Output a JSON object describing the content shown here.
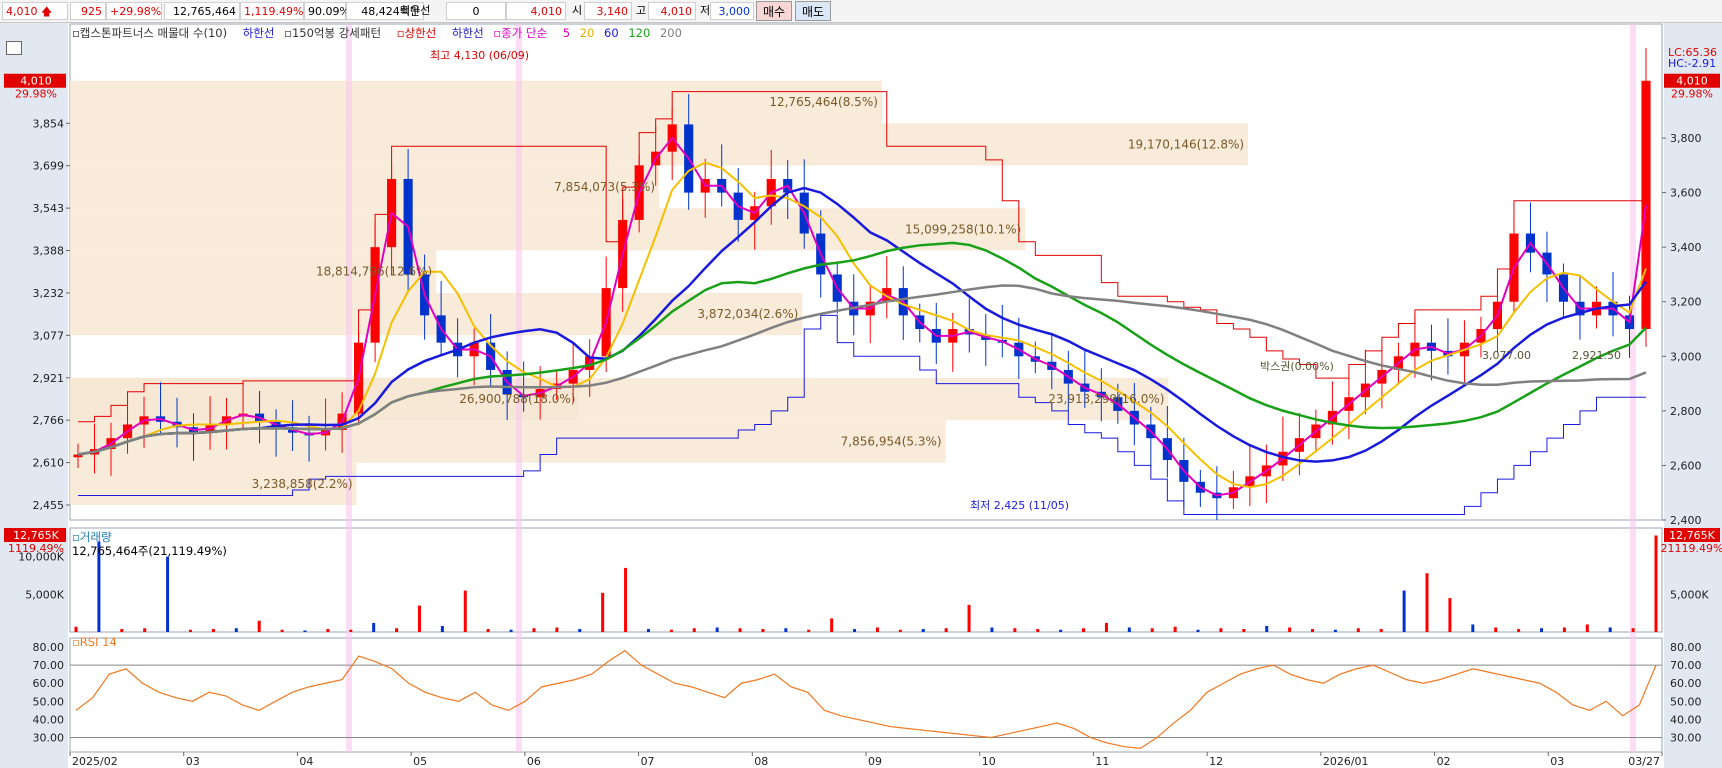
{
  "topbar": {
    "price": "4,010",
    "change": "925",
    "change_pct": "+29.98%",
    "volume": "12,765,464",
    "volume_ratio": "1,119.49%",
    "ratio2": "90.09%",
    "amount": "48,424백만",
    "best_label": "최우선",
    "best_qty": "0",
    "best_price": "4,010",
    "open_label": "시",
    "open": "3,140",
    "high_label": "고",
    "high": "4,010",
    "low_label": "저",
    "low": "3,000",
    "buy_label": "매수",
    "sell_label": "매도"
  },
  "legend_main": {
    "item1": "캡스톤파트너스 매물대 수(10)",
    "item2": "하한선",
    "item3": "150억봉 강세패턴",
    "item4": "상한선",
    "item5": "하한선",
    "item6": "종가 단순",
    "ma5": "5",
    "ma20": "20",
    "ma60": "60",
    "ma120": "120",
    "ma200": "200"
  },
  "annotations": {
    "high_mark": "최고 4,130 (06/09)",
    "low_mark": "최저 2,425 (11/05)",
    "lc": "LC:65.36",
    "hc": "HC:-2.91",
    "breakout": "박스권(0.00%)"
  },
  "price_flags": {
    "left_price": "4,010",
    "left_pct": "29.98%",
    "right_price": "4,010",
    "right_pct": "29.98%"
  },
  "volume_panel": {
    "title": "거래량",
    "value_text": "12,765,464주(21,119.49%)",
    "left_flag": "12,765K",
    "left_flag_pct": "1119.49%",
    "right_flag": "12,765K",
    "right_flag_pct": "21119.49%",
    "tick_10000": "10,000K",
    "tick_5000": "5,000K"
  },
  "rsi_panel": {
    "title": "RSI 14"
  },
  "left_axis": [
    "3,854",
    "3,699",
    "3,543",
    "3,388",
    "3,232",
    "3,077",
    "2,921",
    "2,766",
    "2,610",
    "2,455"
  ],
  "right_axis": [
    "3,800",
    "3,600",
    "3,400",
    "3,200",
    "3,000",
    "2,800",
    "2,600",
    "2,400"
  ],
  "rsi_axis": [
    "80.00",
    "70.00",
    "60.00",
    "50.00",
    "40.00",
    "30.00"
  ],
  "x_axis": [
    "2025/02",
    "03",
    "04",
    "05",
    "06",
    "07",
    "08",
    "09",
    "10",
    "11",
    "12",
    "2026/01",
    "02",
    "03",
    "03/27"
  ],
  "colors": {
    "up": "#ff0000",
    "down": "#0033cc",
    "ma5": "#e000c0",
    "ma20": "#f5c000",
    "ma60": "#1a1adc",
    "ma120": "#18a018",
    "ma200": "#808080",
    "box": "#f7e7d3",
    "rsi": "#f07820"
  },
  "chart_data": {
    "type": "candlestick",
    "title": "캡스톤파트너스 매물대 수(10)",
    "ylim": [
      2400,
      4130
    ],
    "volume_profile": [
      {
        "label": "3,238,858(2.2%)",
        "price_low": 2455,
        "price_high": 2610
      },
      {
        "label": "7,856,954(5.3%)",
        "price_low": 2610,
        "price_high": 2766
      },
      {
        "label": "26,900,788(18.0%)",
        "price_low": 2766,
        "price_high": 2921
      },
      {
        "label": "23,913,299(16.0%)",
        "price_low": 2766,
        "price_high": 2921
      },
      {
        "label": "3,872,034(2.6%)",
        "price_low": 3077,
        "price_high": 3232
      },
      {
        "label": "18,814,796(12.6%)",
        "price_low": 3232,
        "price_high": 3388
      },
      {
        "label": "15,099,258(10.1%)",
        "price_low": 3388,
        "price_high": 3543
      },
      {
        "label": "7,854,073(5.3%)",
        "price_low": 3543,
        "price_high": 3699
      },
      {
        "label": "19,170,146(12.8%)",
        "price_low": 3699,
        "price_high": 3854
      },
      {
        "label": "12,765,464(8.5%)",
        "price_low": 3854,
        "price_high": 4010
      }
    ],
    "ma_right_labels": [
      "3,077.00",
      "2,921.50"
    ],
    "close_series": [
      2640,
      2660,
      2700,
      2750,
      2780,
      2760,
      2740,
      2720,
      2750,
      2780,
      2790,
      2760,
      2740,
      2720,
      2710,
      2730,
      2790,
      3050,
      3400,
      3650,
      3300,
      3150,
      3050,
      3000,
      3050,
      2950,
      2860,
      2850,
      2880,
      2900,
      2950,
      3000,
      3250,
      3500,
      3700,
      3750,
      3850,
      3600,
      3650,
      3600,
      3500,
      3550,
      3650,
      3600,
      3450,
      3300,
      3200,
      3150,
      3200,
      3250,
      3150,
      3100,
      3050,
      3100,
      3080,
      3060,
      3050,
      3000,
      2980,
      2950,
      2900,
      2870,
      2850,
      2800,
      2750,
      2700,
      2620,
      2540,
      2500,
      2480,
      2520,
      2560,
      2600,
      2650,
      2700,
      2750,
      2800,
      2850,
      2900,
      2950,
      3000,
      3050,
      3020,
      3000,
      3050,
      3100,
      3200,
      3450,
      3380,
      3300,
      3200,
      3150,
      3200,
      3150,
      3100,
      4010
    ],
    "rsi_series": [
      45,
      52,
      65,
      68,
      60,
      55,
      52,
      50,
      55,
      53,
      48,
      45,
      50,
      55,
      58,
      60,
      62,
      75,
      72,
      68,
      60,
      55,
      52,
      50,
      55,
      48,
      45,
      50,
      58,
      60,
      62,
      65,
      72,
      78,
      70,
      65,
      60,
      58,
      55,
      52,
      60,
      62,
      65,
      58,
      55,
      45,
      42,
      40,
      38,
      36,
      35,
      34,
      33,
      32,
      31,
      30,
      32,
      34,
      36,
      38,
      35,
      30,
      27,
      25,
      24,
      30,
      38,
      45,
      55,
      60,
      65,
      68,
      70,
      65,
      62,
      60,
      65,
      68,
      70,
      66,
      62,
      60,
      62,
      65,
      68,
      66,
      64,
      62,
      60,
      55,
      48,
      45,
      50,
      42,
      48,
      70
    ],
    "volume_series": [
      0.7,
      12.0,
      0.4,
      0.5,
      10.0,
      0.3,
      0.4,
      0.5,
      1.5,
      0.3,
      0.2,
      0.4,
      0.3,
      1.2,
      0.5,
      3.5,
      0.8,
      5.5,
      0.4,
      0.3,
      0.5,
      0.6,
      0.4,
      5.2,
      8.5,
      0.4,
      0.3,
      0.5,
      0.6,
      0.5,
      0.4,
      0.5,
      0.3,
      1.8,
      0.4,
      0.6,
      0.3,
      0.4,
      0.5,
      3.6,
      0.6,
      0.5,
      0.4,
      0.3,
      0.5,
      1.2,
      0.6,
      0.5,
      0.7,
      0.3,
      0.5,
      0.4,
      0.8,
      0.6,
      0.4,
      0.3,
      0.5,
      0.4,
      5.5,
      7.8,
      4.5,
      1.0,
      0.6,
      0.4,
      0.5,
      0.6,
      1.0,
      0.6,
      0.5,
      12.8
    ]
  }
}
